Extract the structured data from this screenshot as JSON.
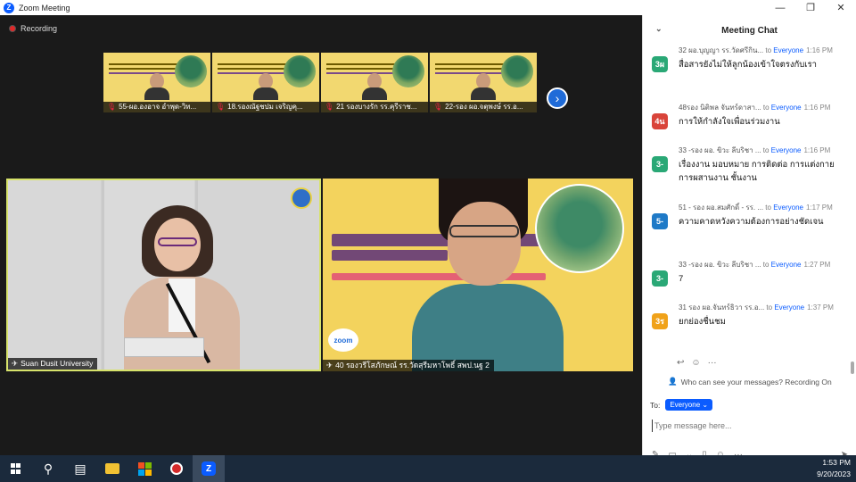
{
  "window": {
    "title": "Zoom Meeting",
    "logo": "Z"
  },
  "window_controls": {
    "minimize": "—",
    "restore": "❐",
    "close": "✕"
  },
  "recording": {
    "label": "Recording"
  },
  "thumbnails": [
    {
      "name": "55-ผอ.องอาจ อำพุด-วิท...",
      "mic_icon": "mic-muted-icon"
    },
    {
      "name": "18.รองณัฐชปม เจริญคุ...",
      "mic_icon": "mic-muted-icon"
    },
    {
      "name": "21 รองบางรัก รร.คุรีราช...",
      "mic_icon": "mic-muted-icon"
    },
    {
      "name": "22-รอง ผอ.จตุพงษ์ รร.อ...",
      "mic_icon": "mic-muted-icon"
    }
  ],
  "next_button": {
    "label": "›"
  },
  "tiles": [
    {
      "name": "Suan Dusit University",
      "pin_icon": "pin-icon"
    },
    {
      "name": "40 รองวรีโสภักษณ์ รร.วัดสุรีมหาโพธิ์ สพป.นฐ 2",
      "pin_icon": "pin-icon",
      "badge": "zoom"
    }
  ],
  "chat": {
    "title": "Meeting Chat",
    "messages": [
      {
        "avatar": "3ผ",
        "color": "#2aa876",
        "sender": "32 ผอ.บุญญา รร.วัดศรีกิน...",
        "to": "to",
        "recipient": "Everyone",
        "time": "1:16 PM",
        "text": "สื่อสารยังไม่ให้ลูกน้องเข้าใจตรงกับเรา"
      },
      {
        "avatar": "4น",
        "color": "#d9443a",
        "sender": "48รอง นิติพล จันทร์ดาสา...",
        "to": "to",
        "recipient": "Everyone",
        "time": "1:16 PM",
        "text": "การให้กำลังใจเพื่อนร่วมงาน"
      },
      {
        "avatar": "3-",
        "color": "#2aa876",
        "sender": "33 -รอง ผอ. ขิวะ ลีบริชา ...",
        "to": "to",
        "recipient": "Everyone",
        "time": "1:16 PM",
        "text": "เรื่องงาน มอบหมาย การติดต่อ การแต่งกาย การผสานงาน ชั้นงาน"
      },
      {
        "avatar": "5-",
        "color": "#1f7ac7",
        "sender": "51 - รอง ผอ.สมศักดิ์ - รร. ...",
        "to": "to",
        "recipient": "Everyone",
        "time": "1:17 PM",
        "text": "ความคาดหวังความต้องการอย่างชัดเจน"
      },
      {
        "avatar": "3-",
        "color": "#2aa876",
        "sender": "33 -รอง ผอ. ขิวะ ลีบริชา ...",
        "to": "to",
        "recipient": "Everyone",
        "time": "1:27 PM",
        "text": "7"
      },
      {
        "avatar": "3ร",
        "color": "#f0a21a",
        "sender": "31 รอง ผอ.จันทร์ธิวา รร.อ...",
        "to": "to",
        "recipient": "Everyone",
        "time": "1:37 PM",
        "text": "ยกย่องชื่นชม"
      }
    ],
    "reactions": [
      "↩",
      "☺",
      "···"
    ],
    "visibility_note": "Who can see your messages? Recording On",
    "to_label": "To:",
    "recipient_pill": "Everyone ⌄",
    "input_placeholder": "Type message here...",
    "tools": [
      "✎",
      "▭",
      "⌄",
      "▯",
      "☺",
      "···"
    ],
    "send": "➤"
  },
  "taskbar": {
    "items": [
      "start-icon",
      "search-icon",
      "task-view-icon",
      "file-explorer-icon",
      "store-icon",
      "app-icon",
      "zoom-icon"
    ],
    "time": "1:53 PM",
    "date": "9/20/2023"
  }
}
